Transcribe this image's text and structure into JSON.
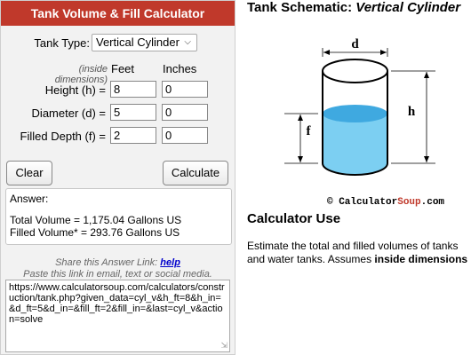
{
  "calculator": {
    "header": "Tank Volume & Fill Calculator",
    "tank_type_label": "Tank Type:",
    "tank_type_value": "Vertical Cylinder",
    "inside_dimensions_note": "(inside dimensions)",
    "col_feet": "Feet",
    "col_inches": "Inches",
    "height_label": "Height (h) =",
    "height_ft": "8",
    "height_in": "0",
    "diameter_label": "Diameter (d) =",
    "diameter_ft": "5",
    "diameter_in": "0",
    "filled_label": "Filled Depth (f) =",
    "filled_ft": "2",
    "filled_in": "0",
    "clear_label": "Clear",
    "calculate_label": "Calculate",
    "answer_heading": "Answer:",
    "total_volume": "Total Volume = 1,175.04 Gallons US",
    "filled_volume": "Filled Volume* = 293.76 Gallons US",
    "share_text": "Share this Answer Link:",
    "share_help": "help",
    "paste_text": "Paste this link in email, text or social media.",
    "share_url": "https://www.calculatorsoup.com/calculators/construction/tank.php?given_data=cyl_v&h_ft=8&h_in=&d_ft=5&d_in=&fill_ft=2&fill_in=&last=cyl_v&action=solve"
  },
  "schematic": {
    "title_prefix": "Tank Schematic: ",
    "title_italic": "Vertical Cylinder",
    "label_d": "d",
    "label_h": "h",
    "label_f": "f",
    "copyright_prefix": "© Calculator",
    "copyright_brand": "Soup",
    "copyright_suffix": ".com",
    "water_color": "#7ccff2",
    "water_top_color": "#3fa9e0"
  },
  "usage": {
    "heading": "Calculator Use",
    "text_line1": "Estimate the total and filled volumes of tanks",
    "text_line2_prefix": "and water tanks.  Assumes ",
    "text_line2_bold": "inside dimensions"
  },
  "colors": {
    "header_red": "#c0392b",
    "link_blue": "#0000cc"
  }
}
